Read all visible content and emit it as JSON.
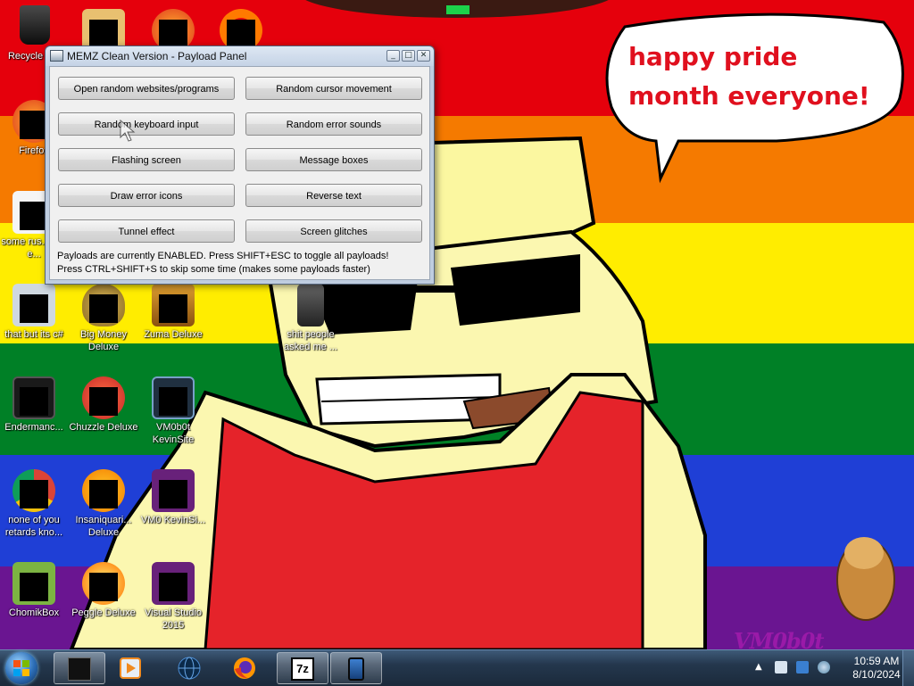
{
  "wallpaper": {
    "bubble_text": "happy pride month everyone!",
    "watermark": "VM0b0t",
    "colors": [
      "#e5000c",
      "#f57a00",
      "#ffed00",
      "#008026",
      "#1f3fd6",
      "#6a1591"
    ]
  },
  "desktop_icons": [
    {
      "label": "Recycle Bin",
      "icon": "recycle-bin-icon"
    },
    {
      "label": "Firefox",
      "icon": "firefox-icon"
    },
    {
      "label": "some rus... ran e...",
      "icon": "folder-icon"
    },
    {
      "label": "that but its c#",
      "icon": "file-icon"
    },
    {
      "label": "Endermanc...",
      "icon": "terminal-icon"
    },
    {
      "label": "none of you retards kno...",
      "icon": "chrome-icon"
    },
    {
      "label": "ChomikBox",
      "icon": "chomikbox-icon"
    },
    {
      "label": "Big Money Deluxe",
      "icon": "money-bag-icon"
    },
    {
      "label": "Chuzzle Deluxe",
      "icon": "chuzzle-icon"
    },
    {
      "label": "Insaniquari... Deluxe",
      "icon": "fish-icon"
    },
    {
      "label": "Peggle Deluxe",
      "icon": "peggle-icon"
    },
    {
      "label": "Zuma Deluxe",
      "icon": "zuma-icon"
    },
    {
      "label": "VM0b0t KevinSite",
      "icon": "monitor-icon"
    },
    {
      "label": "VM0 KevinSi...",
      "icon": "visual-studio-icon"
    },
    {
      "label": "Visual Studio 2015",
      "icon": "visual-studio-icon"
    },
    {
      "label": "shit people asked me ...",
      "icon": "folder-icon"
    }
  ],
  "memz_window": {
    "title": "MEMZ Clean Version - Payload Panel",
    "controls": {
      "minimize": "_",
      "maximize": "□",
      "close": "✕"
    },
    "buttons": [
      "Open random websites/programs",
      "Random cursor movement",
      "Random keyboard input",
      "Random error sounds",
      "Flashing screen",
      "Message boxes",
      "Draw error icons",
      "Reverse text",
      "Tunnel effect",
      "Screen glitches"
    ],
    "status_line1": "Payloads are currently ENABLED. Press SHIFT+ESC to toggle all payloads!",
    "status_line2": "Press CTRL+SHIFT+S to skip some time (makes some payloads faster)"
  },
  "taskbar": {
    "start": "start-orb",
    "items": [
      {
        "icon": "black-app-icon",
        "active": true
      },
      {
        "icon": "media-player-icon",
        "active": false
      },
      {
        "icon": "globe-icon",
        "active": false
      },
      {
        "icon": "firefox-icon",
        "active": false
      },
      {
        "icon": "7zip-icon",
        "label": "7z",
        "active": true
      },
      {
        "icon": "phone-icon",
        "active": true
      }
    ],
    "tray": {
      "expand": "▲",
      "time": "10:59 AM",
      "date": "8/10/2024"
    }
  }
}
